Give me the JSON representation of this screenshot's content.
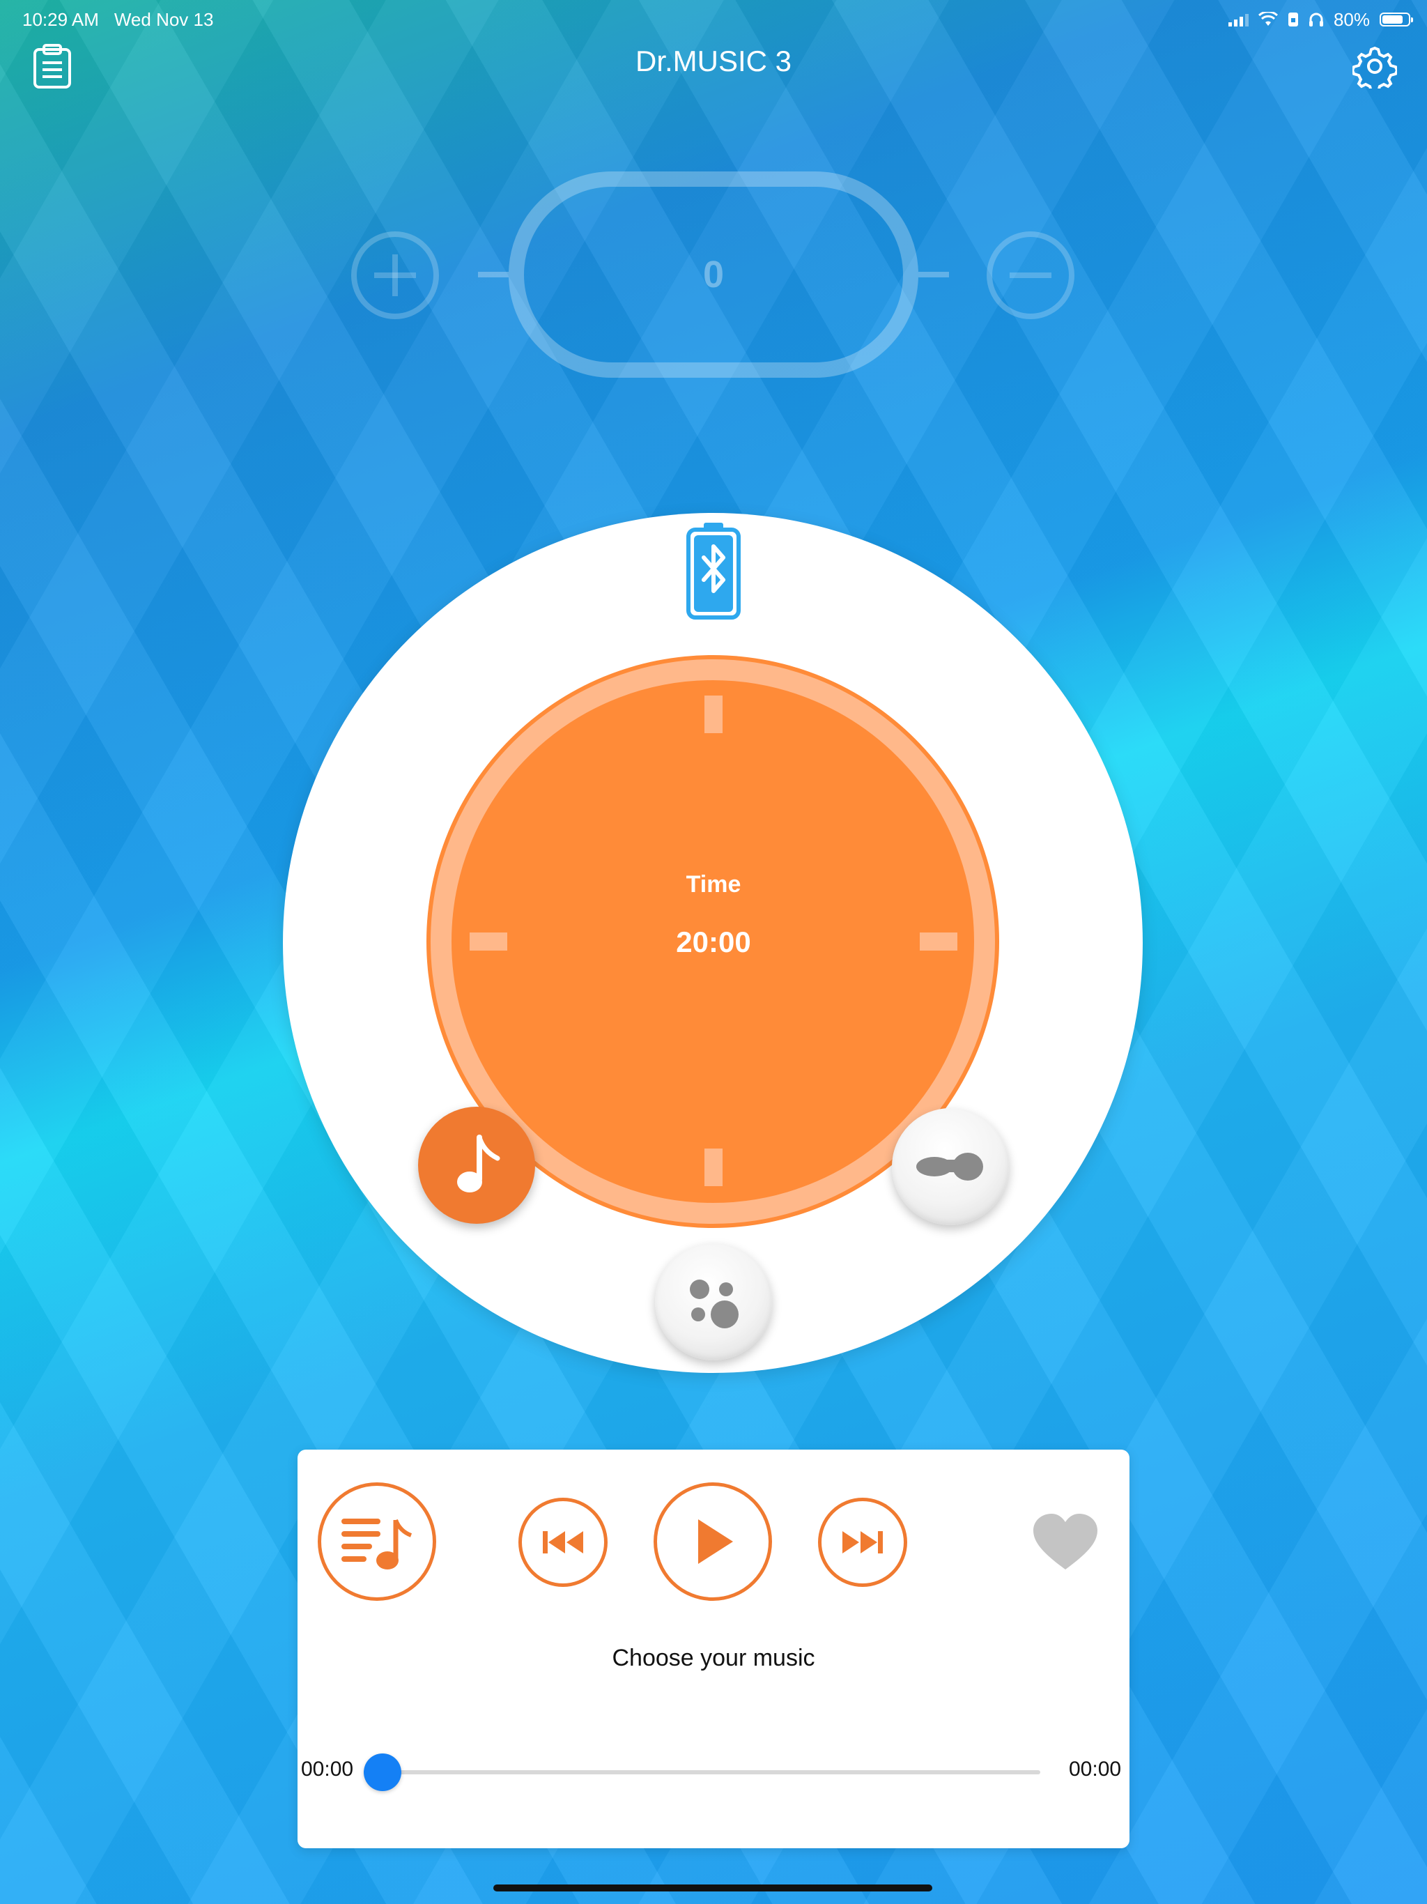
{
  "status_bar": {
    "time": "10:29 AM",
    "date": "Wed Nov 13",
    "battery_percent": "80%",
    "battery_level": 0.8,
    "icons": [
      "signal-icon",
      "wifi-icon",
      "lock-rotation-icon",
      "headphones-icon",
      "battery-icon"
    ]
  },
  "header": {
    "title": "Dr.MUSIC 3",
    "left_icon": "clipboard-icon",
    "right_icon": "gear-icon"
  },
  "counter": {
    "value": "0",
    "plus_icon": "plus-circle-icon",
    "minus_icon": "minus-circle-icon"
  },
  "dial": {
    "bluetooth_icon": "bluetooth-battery-icon",
    "label": "Time",
    "time_value": "20:00",
    "modes": [
      {
        "icon": "music-note-icon",
        "active": true
      },
      {
        "icon": "dots-pattern-icon",
        "active": false
      },
      {
        "icon": "wave-pattern-icon",
        "active": false
      }
    ]
  },
  "player": {
    "track_name": "Choose your music",
    "elapsed": "00:00",
    "total": "00:00",
    "progress": 0,
    "buttons": [
      "playlist-icon",
      "previous-icon",
      "play-icon",
      "next-icon",
      "heart-icon"
    ]
  },
  "colors": {
    "accent_orange": "#ff8b38",
    "button_orange": "#f07a30",
    "progress_blue": "#1480f5",
    "favorite_gray": "#c4c4c4"
  }
}
